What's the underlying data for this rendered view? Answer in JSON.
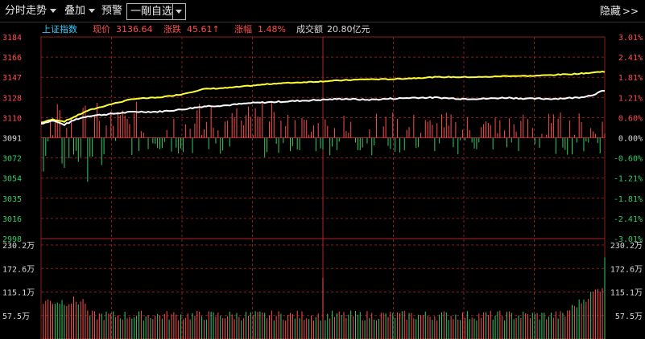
{
  "toolbar": {
    "time_share": "分时走势",
    "overlay": "叠加",
    "alert": "预警",
    "watchlist": "一剛自选",
    "hide": "隐藏"
  },
  "info_bar": {
    "index_name": "上证指数",
    "price_label": "现价",
    "price_value": "3136.64",
    "change_label": "涨跌",
    "change_value": "45.61↑",
    "pct_label": "涨幅",
    "pct_value": "1.48%",
    "amount_label": "成交额",
    "amount_value": "20.80亿元"
  },
  "colors": {
    "up": "#ff4d4d",
    "down": "#33cc66",
    "price_line": "#ffffff",
    "avg_line": "#ffff33",
    "grid": "#8b1e1e",
    "axis_text_left": "#ff4d4d",
    "index_name": "#33ccff"
  },
  "chart_data": [
    {
      "type": "line",
      "subtype": "intraday-price",
      "previous_close": 3091,
      "y_left_ticks": [
        "3184",
        "3166",
        "3147",
        "3128",
        "3110",
        "3091",
        "3072",
        "3054",
        "3035",
        "3016",
        "2998"
      ],
      "y_right_ticks": [
        "3.01%",
        "2.41%",
        "1.81%",
        "1.21%",
        "0.60%",
        "0.00%",
        "-0.60%",
        "-1.21%",
        "-1.81%",
        "-2.41%",
        "-3.01%"
      ],
      "ylim": [
        2998,
        3184
      ],
      "series": [
        {
          "key": "price",
          "color": "#ffffff",
          "points": [
            [
              0,
              3104
            ],
            [
              5,
              3107
            ],
            [
              10,
              3103
            ],
            [
              15,
              3108
            ],
            [
              20,
              3111
            ],
            [
              30,
              3113
            ],
            [
              40,
              3115
            ],
            [
              50,
              3115
            ],
            [
              60,
              3117
            ],
            [
              70,
              3120
            ],
            [
              80,
              3121
            ],
            [
              90,
              3123
            ],
            [
              100,
              3124
            ],
            [
              110,
              3125
            ],
            [
              120,
              3126
            ],
            [
              130,
              3127
            ],
            [
              140,
              3126
            ],
            [
              150,
              3127
            ],
            [
              160,
              3128
            ],
            [
              170,
              3128
            ],
            [
              180,
              3127
            ],
            [
              190,
              3127
            ],
            [
              200,
              3128
            ],
            [
              210,
              3127
            ],
            [
              220,
              3127
            ],
            [
              230,
              3128
            ],
            [
              236,
              3130
            ],
            [
              241,
              3134
            ],
            [
              242,
              3134
            ]
          ]
        },
        {
          "key": "average",
          "color": "#ffff33",
          "points": [
            [
              0,
              3105
            ],
            [
              5,
              3108
            ],
            [
              10,
              3106
            ],
            [
              15,
              3111
            ],
            [
              20,
              3116
            ],
            [
              30,
              3122
            ],
            [
              40,
              3127
            ],
            [
              50,
              3128
            ],
            [
              60,
              3131
            ],
            [
              70,
              3136
            ],
            [
              80,
              3137
            ],
            [
              90,
              3139
            ],
            [
              100,
              3141
            ],
            [
              110,
              3142
            ],
            [
              120,
              3143
            ],
            [
              130,
              3144
            ],
            [
              140,
              3145
            ],
            [
              150,
              3145
            ],
            [
              160,
              3146
            ],
            [
              170,
              3147
            ],
            [
              180,
              3147
            ],
            [
              190,
              3147
            ],
            [
              200,
              3148
            ],
            [
              210,
              3148
            ],
            [
              220,
              3149
            ],
            [
              230,
              3150
            ],
            [
              236,
              3151
            ],
            [
              241,
              3152
            ],
            [
              242,
              3152
            ]
          ]
        }
      ]
    },
    {
      "type": "bar",
      "subtype": "volume",
      "y_ticks": [
        "230.2万",
        "172.6万",
        "115.1万",
        "57.5万"
      ],
      "ylim": [
        0,
        230.2
      ],
      "unit": "万"
    }
  ]
}
